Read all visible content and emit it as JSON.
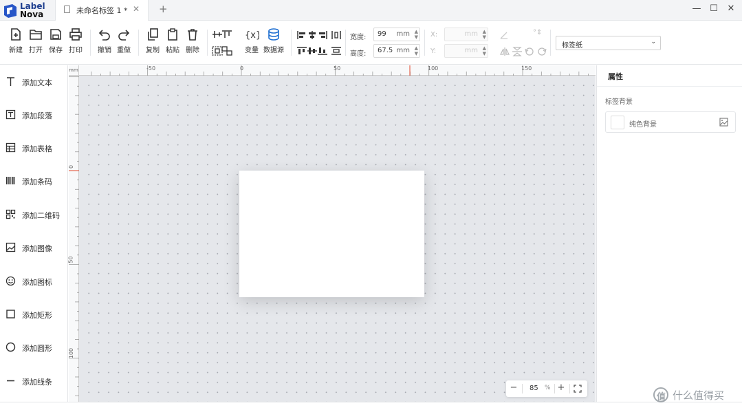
{
  "app": {
    "logo_line1": "Label",
    "logo_line2": "Nova",
    "brand_color": "#1f3f8f"
  },
  "tabs": [
    {
      "label": "未命名标签 1 *"
    }
  ],
  "toolbar": {
    "new_label": "新建",
    "open_label": "打开",
    "save_label": "保存",
    "print_label": "打印",
    "undo_label": "撤销",
    "redo_label": "重做",
    "copy_label": "复制",
    "paste_label": "粘贴",
    "delete_label": "删除",
    "variable_label": "变量",
    "datasource_label": "数据源",
    "width_label": "宽度:",
    "width_value": "99",
    "height_label": "高度:",
    "height_value": "67.5",
    "unit": "mm",
    "x_label": "X:",
    "y_label": "Y:",
    "paper_select": "标签纸"
  },
  "sidebar": {
    "items": [
      {
        "label": "添加文本",
        "icon": "text-icon"
      },
      {
        "label": "添加段落",
        "icon": "paragraph-icon"
      },
      {
        "label": "添加表格",
        "icon": "table-icon"
      },
      {
        "label": "添加条码",
        "icon": "barcode-icon"
      },
      {
        "label": "添加二维码",
        "icon": "qrcode-icon"
      },
      {
        "label": "添加图像",
        "icon": "image-icon"
      },
      {
        "label": "添加图标",
        "icon": "smiley-icon"
      },
      {
        "label": "添加矩形",
        "icon": "rectangle-icon"
      },
      {
        "label": "添加圆形",
        "icon": "circle-icon"
      },
      {
        "label": "添加线条",
        "icon": "line-icon"
      }
    ]
  },
  "canvas": {
    "ruler_unit": "mm",
    "top_ticks": [
      "-50",
      "0",
      "50",
      "100",
      "150"
    ],
    "left_ticks": [
      "0",
      "50",
      "100"
    ],
    "zoom_value": "85",
    "zoom_unit": "%"
  },
  "properties": {
    "title": "属性",
    "section": "标签背景",
    "background_label": "纯色背景"
  },
  "watermark": {
    "badge": "值",
    "text": "什么值得买"
  }
}
